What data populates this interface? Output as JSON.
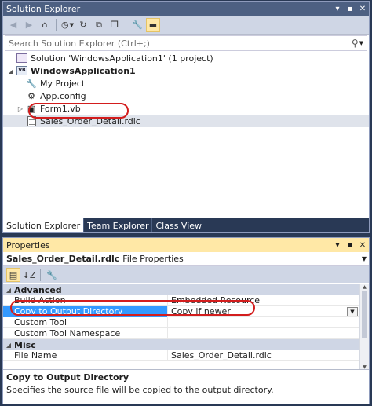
{
  "solution_explorer": {
    "title": "Solution Explorer",
    "title_buttons": [
      "▾",
      "▪",
      "✕"
    ],
    "search_placeholder": "Search Solution Explorer (Ctrl+;)",
    "tree": {
      "solution": "Solution 'WindowsApplication1' (1 project)",
      "project": "WindowsApplication1",
      "my_project": "My Project",
      "app_config": "App.config",
      "form1": "Form1.vb",
      "rdlc": "Sales_Order_Detail.rdlc"
    },
    "tabs": [
      "Solution Explorer",
      "Team Explorer",
      "Class View"
    ]
  },
  "properties": {
    "title": "Properties",
    "title_buttons": [
      "▾",
      "▪",
      "✕"
    ],
    "object_name": "Sales_Order_Detail.rdlc",
    "object_type": "File Properties",
    "categories": {
      "advanced": "Advanced",
      "misc": "Misc"
    },
    "rows": {
      "build_action": {
        "name": "Build Action",
        "value": "Embedded Resource"
      },
      "copy_output": {
        "name": "Copy to Output Directory",
        "value": "Copy if newer"
      },
      "custom_tool": {
        "name": "Custom Tool",
        "value": ""
      },
      "custom_tool_ns": {
        "name": "Custom Tool Namespace",
        "value": ""
      },
      "file_name": {
        "name": "File Name",
        "value": "Sales_Order_Detail.rdlc"
      }
    },
    "description_title": "Copy to Output Directory",
    "description_text": "Specifies the source file will be copied to the output directory."
  },
  "colors": {
    "chrome": "#293955",
    "highlight": "#3399ff",
    "annotation": "#d31d1d",
    "active_title": "#ffe8a6"
  }
}
